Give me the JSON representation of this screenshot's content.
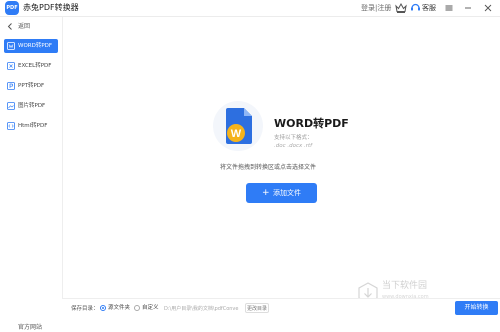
{
  "app": {
    "logo_text": "PDF",
    "title": "赤兔PDF转换器",
    "login_label": "登录|注册",
    "service_label": "客服"
  },
  "sidebar": {
    "back_label": "返回",
    "items": [
      {
        "label": "WORD转PDF",
        "icon": "word-icon",
        "active": true
      },
      {
        "label": "EXCEL转PDF",
        "icon": "excel-icon",
        "active": false
      },
      {
        "label": "PPT转PDF",
        "icon": "ppt-icon",
        "active": false
      },
      {
        "label": "图片转PDF",
        "icon": "image-icon",
        "active": false
      },
      {
        "label": "Html转PDF",
        "icon": "html-icon",
        "active": false
      }
    ],
    "official_site": "官方网站"
  },
  "main": {
    "doc_letter": "W",
    "title": "WORD转PDF",
    "formats_label": "支持以下格式：",
    "formats_ext": ".doc .docx .rtf",
    "hint": "将文件拖拽到转换区或点击选择文件",
    "add_button": "添加文件"
  },
  "footer": {
    "output_label": "保存目录：",
    "option_source": "源文件夹",
    "option_custom": "自定义",
    "path": "D:\\用户目录\\我的文档\\pdfConve",
    "change_label": "更改目录",
    "start_button": "开始转换"
  },
  "watermark": {
    "line1": "当下软件园",
    "line2": "www.downxia.com"
  },
  "colors": {
    "accent": "#2f7cf6",
    "doc_blue": "#2d6fe0",
    "doc_badge": "#f5b31b"
  }
}
